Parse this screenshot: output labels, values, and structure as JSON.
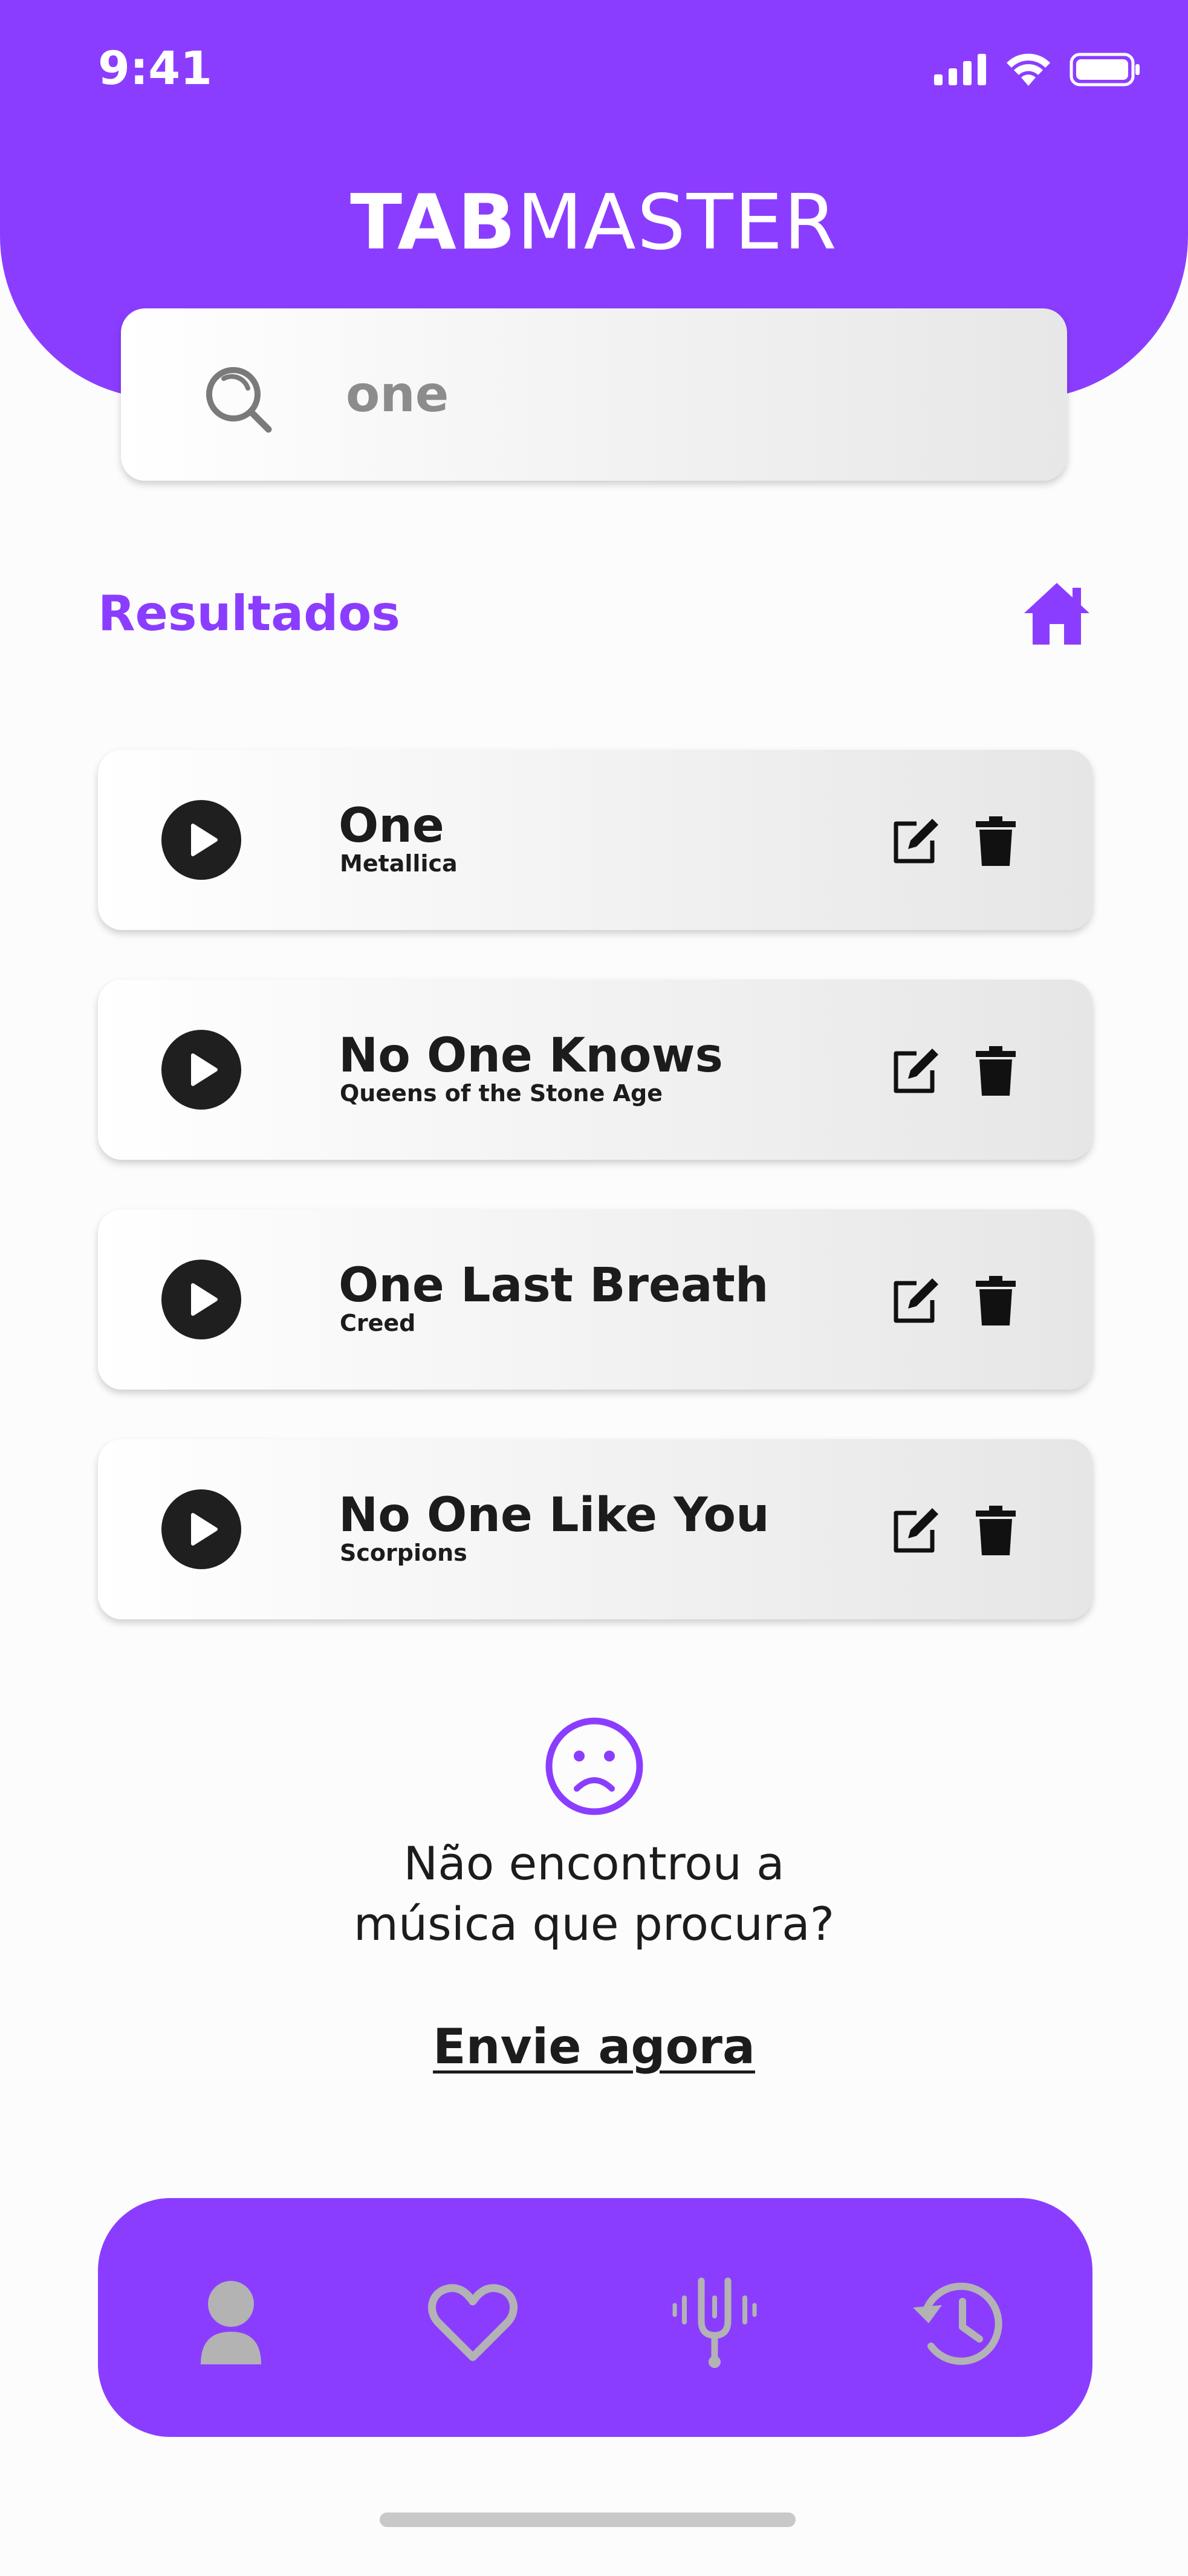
{
  "status_bar": {
    "time": "9:41"
  },
  "header": {
    "title_bold": "TAB",
    "title_light": "MASTER"
  },
  "search": {
    "value": "one",
    "icon": "search-icon"
  },
  "results": {
    "title": "Resultados",
    "home_icon": "home-icon"
  },
  "songs": [
    {
      "title": "One",
      "artist": "Metallica"
    },
    {
      "title": "No One Knows",
      "artist": "Queens of the Stone Age"
    },
    {
      "title": "One Last Breath",
      "artist": "Creed"
    },
    {
      "title": "No One Like You",
      "artist": "Scorpions"
    }
  ],
  "not_found": {
    "line1": "Não encontrou a",
    "line2": "música que procura?",
    "link": "Envie agora",
    "icon": "sad-face-icon"
  },
  "bottom_nav": {
    "items": [
      "profile-icon",
      "heart-icon",
      "tuning-fork-icon",
      "history-icon"
    ]
  },
  "colors": {
    "accent": "#8b3dff",
    "nav_icon": "#b3b3b3",
    "text_dark": "#1c1c1c"
  }
}
